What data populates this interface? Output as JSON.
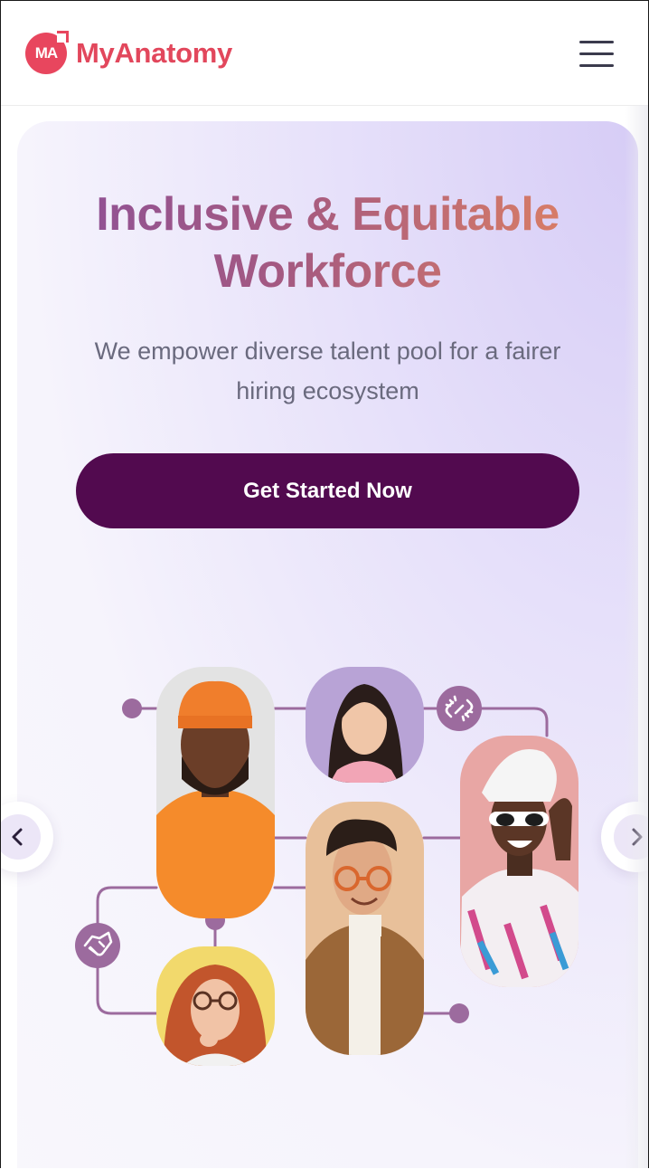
{
  "header": {
    "logo_mark": "MA",
    "brand": "MyAnatomy",
    "menu_icon": "hamburger-menu-icon"
  },
  "hero": {
    "title_line1": "Inclusive & Equitable",
    "title_line2": "Workforce",
    "subtitle": "We empower diverse talent pool for a fairer hiring ecosystem",
    "cta_label": "Get Started Now"
  },
  "carousel": {
    "prev_icon": "chevron-left-icon",
    "next_icon": "chevron-right-icon",
    "photos": [
      "man-orange-beanie-photo",
      "smiling-woman-photo",
      "woman-sunglasses-towel-photo",
      "man-glasses-turtleneck-photo",
      "redhead-woman-glasses-photo"
    ],
    "connector_icons": [
      "broken-link-icon",
      "handshake-icon"
    ]
  },
  "colors": {
    "brand": "#e2475c",
    "cta": "#520a4f",
    "connector": "#9c6b9e"
  }
}
